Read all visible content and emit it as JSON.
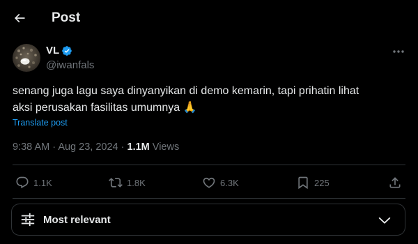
{
  "header": {
    "title": "Post",
    "back_icon": "arrow-left-icon"
  },
  "tweet": {
    "author": {
      "display_name": "VL",
      "handle": "@iwanfals",
      "verified": true,
      "verified_color": "#1d9bf0"
    },
    "text_lines": [
      "senang juga lagu saya dinyanyikan di demo kemarin, tapi prihatin lihat",
      "aksi perusakan fasilitas umumnya 🙏"
    ],
    "translate_label": "Translate post",
    "time": "9:38 AM",
    "date": "Aug 23, 2024",
    "separator": "·",
    "views_count": "1.1M",
    "views_label": "Views"
  },
  "actions": {
    "replies": "1.1K",
    "reposts": "1.8K",
    "likes": "6.3K",
    "bookmarks": "225"
  },
  "sort": {
    "label": "Most relevant"
  },
  "colors": {
    "background": "#000000",
    "text": "#e7e9ea",
    "muted": "#71767b",
    "accent": "#1d9bf0",
    "border": "#2f3336"
  }
}
